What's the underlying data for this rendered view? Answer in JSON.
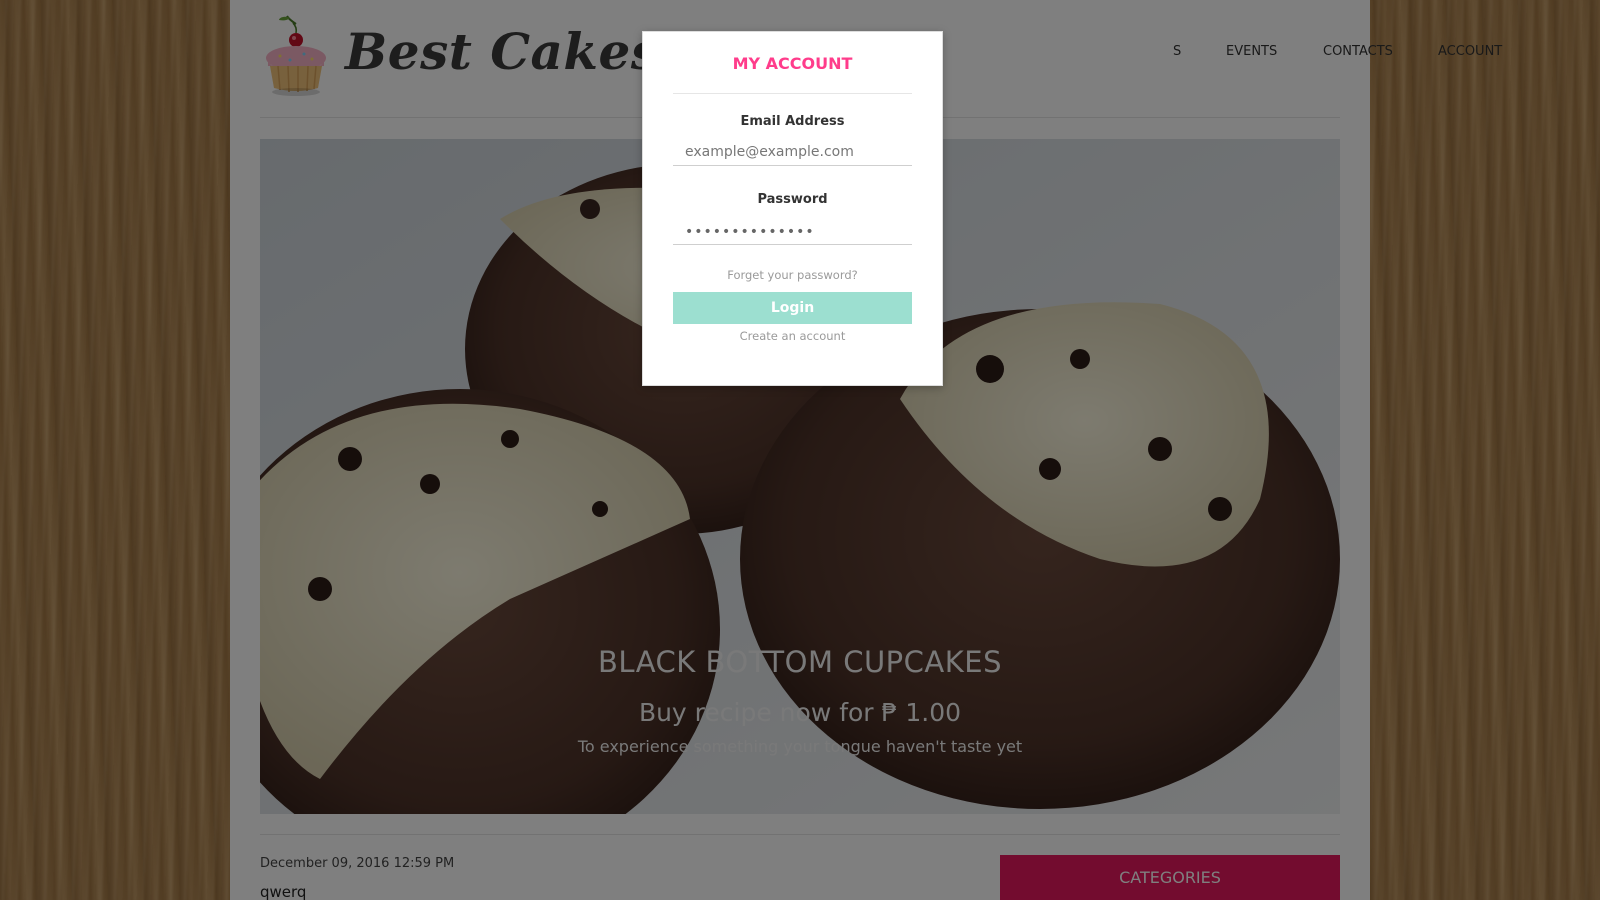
{
  "header": {
    "brand": "Best Cakes",
    "nav": [
      {
        "label": "S"
      },
      {
        "label": "EVENTS"
      },
      {
        "label": "CONTACTS"
      },
      {
        "label": "ACCOUNT"
      }
    ]
  },
  "hero": {
    "title": "BLACK BOTTOM CUPCAKES",
    "subtitle": "Buy recipe now for ₱ 1.00",
    "tagline": "To experience something your tongue haven't taste yet"
  },
  "post": {
    "date": "December 09, 2016 12:59 PM",
    "title": "qwerq"
  },
  "sidebar": {
    "categories_label": "CATEGORIES"
  },
  "modal": {
    "title": "MY ACCOUNT",
    "email_label": "Email Address",
    "email_placeholder": "example@example.com",
    "password_label": "Password",
    "password_value": "••••••••••••••",
    "forgot_link": "Forget your password?",
    "login_label": "Login",
    "create_link": "Create an account"
  },
  "colors": {
    "accent_pink": "#ff3c8b",
    "categories_bg": "#e6195e",
    "login_bg": "#9cdfd0"
  }
}
